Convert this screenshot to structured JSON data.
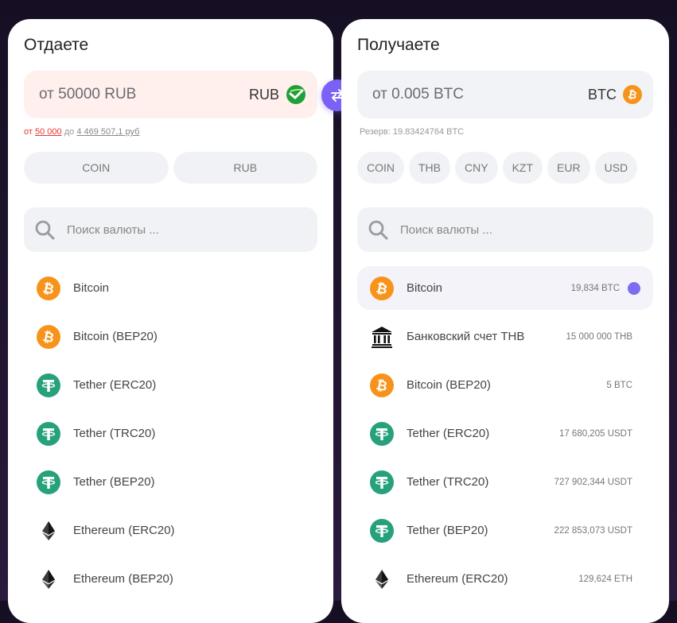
{
  "give": {
    "title": "Отдаете",
    "amount_text": "от 50000 RUB",
    "currency_code": "RUB",
    "currency_icon": "sberbank-icon",
    "limits": {
      "from_label": "от",
      "min": "50 000",
      "to_label": "до",
      "max": "4 469 507,1 руб"
    },
    "filters": [
      "COIN",
      "RUB"
    ],
    "search_placeholder": "Поиск валюты ...",
    "items": [
      {
        "name": "Bitcoin",
        "icon": "bitcoin-icon"
      },
      {
        "name": "Bitcoin (BEP20)",
        "icon": "bitcoin-icon"
      },
      {
        "name": "Tether (ERC20)",
        "icon": "tether-icon"
      },
      {
        "name": "Tether (TRC20)",
        "icon": "tether-icon"
      },
      {
        "name": "Tether (BEP20)",
        "icon": "tether-icon"
      },
      {
        "name": "Ethereum (ERC20)",
        "icon": "ethereum-icon"
      },
      {
        "name": "Ethereum (BEP20)",
        "icon": "ethereum-icon"
      }
    ]
  },
  "get": {
    "title": "Получаете",
    "amount_text": "от 0.005 BTC",
    "currency_code": "BTC",
    "currency_icon": "bitcoin-icon",
    "reserve_text": "Резерв: 19.83424764 BTC",
    "filters": [
      "COIN",
      "THB",
      "CNY",
      "KZT",
      "EUR",
      "USD"
    ],
    "search_placeholder": "Поиск валюты ...",
    "items": [
      {
        "name": "Bitcoin",
        "reserve": "19,834 BTC",
        "icon": "bitcoin-icon",
        "selected": true
      },
      {
        "name": "Банковский счет THB",
        "reserve": "15 000 000 THB",
        "icon": "bank-icon"
      },
      {
        "name": "Bitcoin (BEP20)",
        "reserve": "5 BTC",
        "icon": "bitcoin-icon"
      },
      {
        "name": "Tether (ERC20)",
        "reserve": "17 680,205 USDT",
        "icon": "tether-icon"
      },
      {
        "name": "Tether (TRC20)",
        "reserve": "727 902,344 USDT",
        "icon": "tether-icon"
      },
      {
        "name": "Tether (BEP20)",
        "reserve": "222 853,073 USDT",
        "icon": "tether-icon"
      },
      {
        "name": "Ethereum (ERC20)",
        "reserve": "129,624 ETH",
        "icon": "ethereum-icon"
      }
    ]
  },
  "colors": {
    "accent": "#7b61f5",
    "bitcoin": "#f7931a",
    "tether": "#26a17b",
    "sber": "#21a038",
    "limit_red": "#e53935"
  }
}
